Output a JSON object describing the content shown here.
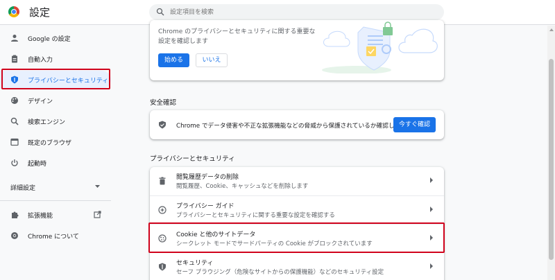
{
  "app": {
    "title": "設定"
  },
  "search": {
    "placeholder": "設定項目を検索"
  },
  "sidebar": {
    "items": [
      {
        "label": "Google の設定",
        "icon": "person-icon"
      },
      {
        "label": "自動入力",
        "icon": "clipboard-icon"
      },
      {
        "label": "プライバシーとセキュリティ",
        "icon": "shield-icon",
        "active": true
      },
      {
        "label": "デザイン",
        "icon": "palette-icon"
      },
      {
        "label": "検索エンジン",
        "icon": "search-icon"
      },
      {
        "label": "既定のブラウザ",
        "icon": "browser-icon"
      },
      {
        "label": "起動時",
        "icon": "power-icon"
      }
    ],
    "advanced_label": "詳細設定",
    "extensions_label": "拡張機能",
    "about_label": "Chrome について"
  },
  "promo": {
    "text": "Chrome のプライバシーとセキュリティに関する重要な設定を確認します",
    "start_label": "始める",
    "no_label": "いいえ"
  },
  "safety_check": {
    "title": "安全確認",
    "text": "Chrome でデータ侵害や不正な拡張機能などの脅威から保護されているか確認します",
    "button_label": "今すぐ確認"
  },
  "privacy": {
    "title": "プライバシーとセキュリティ",
    "rows": [
      {
        "title": "閲覧履歴データの削除",
        "subtitle": "閲覧履歴、Cookie、キャッシュなどを削除します",
        "icon": "trash-icon"
      },
      {
        "title": "プライバシー ガイド",
        "subtitle": "プライバシーとセキュリティに関する重要な設定を確認する",
        "icon": "compass-icon"
      },
      {
        "title": "Cookie と他のサイトデータ",
        "subtitle": "シークレット モードでサードパーティの Cookie がブロックされています",
        "icon": "cookie-icon"
      },
      {
        "title": "セキュリティ",
        "subtitle": "セーフ ブラウジング（危険なサイトからの保護機能）などのセキュリティ設定",
        "icon": "shield-icon"
      }
    ]
  },
  "colors": {
    "accent": "#1a73e8",
    "highlight": "#d0021b"
  }
}
